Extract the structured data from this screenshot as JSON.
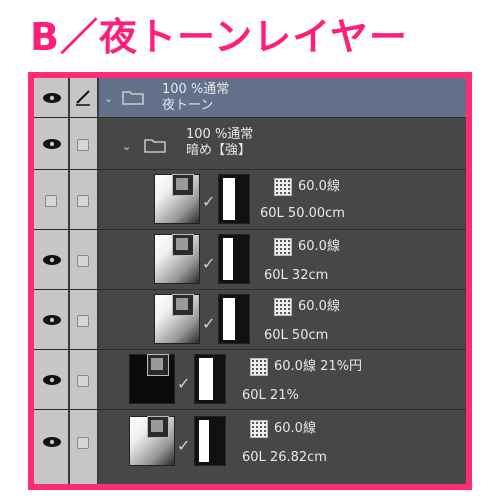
{
  "title": "B／夜トーンレイヤー",
  "folders": [
    {
      "opacity_mode": "100 %通常",
      "name": "夜トーン"
    },
    {
      "opacity_mode": "100 %通常",
      "name": "暗め【強】"
    }
  ],
  "layers": [
    {
      "tone_info": "60.0線",
      "sub_info": "60L 50.00cm"
    },
    {
      "tone_info": "60.0線",
      "sub_info": "60L 32cm"
    },
    {
      "tone_info": "60.0線",
      "sub_info": "60L 50cm"
    },
    {
      "tone_info": "60.0線 21%円",
      "sub_info": "60L 21%"
    },
    {
      "tone_info": "60.0線",
      "sub_info": "60L 26.82cm"
    }
  ],
  "colors": {
    "accent": "#ff2b73",
    "title": "#ff1f7a",
    "selected_row": "#62708a",
    "panel": "#474747"
  }
}
